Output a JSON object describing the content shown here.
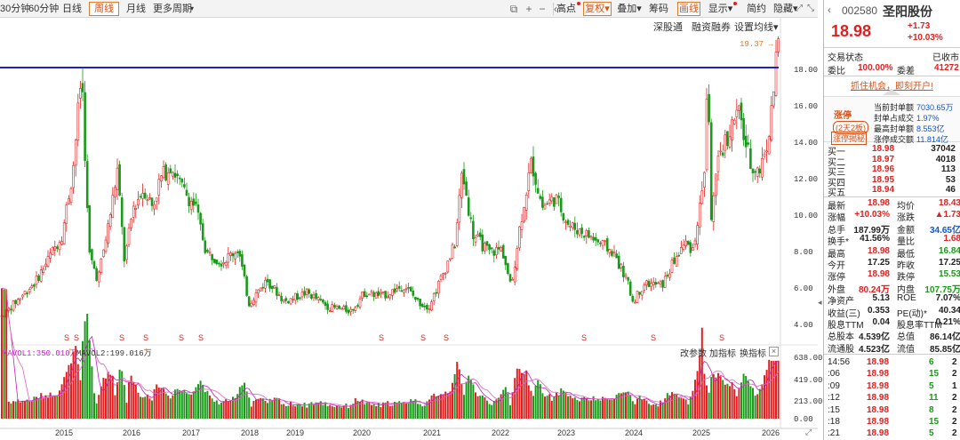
{
  "toolbar": {
    "periods": [
      "30分钟",
      "60分钟",
      "日线",
      "周线",
      "月线",
      "更多周期"
    ],
    "active_period": "周线",
    "right_buttons": [
      "高点",
      "复权",
      "叠加",
      "筹码",
      "画线",
      "显示",
      "简约",
      "隐藏"
    ],
    "icons": [
      "copy-icon",
      "plus-icon",
      "minus-icon",
      "prev-icon",
      "next-icon"
    ],
    "window_icons": [
      "restore-icon",
      "grid-icon",
      "collapse-icon"
    ]
  },
  "chart_links": [
    "深股通",
    "融资融券",
    "设置均线"
  ],
  "price_marker": "19.37",
  "reference_line_label": "",
  "y_axis_price": [
    "18.00",
    "16.00",
    "14.00",
    "12.00",
    "10.00",
    "8.00",
    "6.00",
    "4.00"
  ],
  "y_axis_volume": [
    "638.00",
    "419.00",
    "213.00",
    "0.00"
  ],
  "volume_header": {
    "mavol1": "MAVOL1:350.010万",
    "mavol2": "MAVOL2:199.016万",
    "links": [
      "改参数",
      "加指标",
      "换指标"
    ]
  },
  "years": [
    "2015",
    "2016",
    "2017",
    "2018",
    "2019",
    "2020",
    "2021",
    "2022",
    "2023",
    "2024",
    "2025",
    "2026"
  ],
  "dividend_marker": "S",
  "stock": {
    "code": "002580",
    "name": "圣阳股份",
    "price": "18.98",
    "change": "+1.73",
    "change_pct": "+10.03%"
  },
  "panel": {
    "trade_status_label": "交易状态",
    "trade_status": "已收市",
    "wb_label": "委比",
    "wb": "100.00%",
    "wc_label": "委差",
    "wc": "41272",
    "promo": "抓住机会，即刻开户!",
    "limit": {
      "tag": "涨停",
      "days": "(2天2板)",
      "reveal": "涨停揭秘",
      "rows": [
        {
          "label": "当前封单额",
          "value": "7030.65万"
        },
        {
          "label": "封单占成交",
          "value": "1.97%"
        },
        {
          "label": "最高封单额",
          "value": "8.553亿"
        },
        {
          "label": "涨停成交额",
          "value": "11.814亿"
        }
      ]
    },
    "bids": [
      {
        "label": "买一",
        "price": "18.98",
        "vol": "37042"
      },
      {
        "label": "买二",
        "price": "18.97",
        "vol": "4018"
      },
      {
        "label": "买三",
        "price": "18.96",
        "vol": "113"
      },
      {
        "label": "买四",
        "price": "18.95",
        "vol": "53"
      },
      {
        "label": "买五",
        "price": "18.94",
        "vol": "46"
      }
    ],
    "stats": [
      {
        "l1": "最新",
        "v1": "18.98",
        "c1": "red",
        "l2": "均价",
        "v2": "18.43",
        "c2": "red"
      },
      {
        "l1": "涨幅",
        "v1": "+10.03%",
        "c1": "red",
        "l2": "涨跌",
        "v2": "▲1.73",
        "c2": "red"
      },
      {
        "l1": "总手",
        "v1": "187.99万",
        "c1": "",
        "l2": "金额",
        "v2": "34.65亿",
        "c2": "blue"
      },
      {
        "l1": "换手*",
        "v1": "41.56%",
        "c1": "",
        "l2": "量比",
        "v2": "1.68",
        "c2": "red"
      },
      {
        "l1": "最高",
        "v1": "18.98",
        "c1": "red",
        "l2": "最低",
        "v2": "16.84",
        "c2": "green"
      },
      {
        "l1": "今开",
        "v1": "17.25",
        "c1": "",
        "l2": "昨收",
        "v2": "17.25",
        "c2": ""
      },
      {
        "l1": "涨停",
        "v1": "18.98",
        "c1": "red",
        "l2": "跌停",
        "v2": "15.53",
        "c2": "green"
      },
      {
        "l1": "外盘",
        "v1": "80.24万",
        "c1": "red",
        "l2": "内盘",
        "v2": "107.75万",
        "c2": "green"
      },
      {
        "l1": "净资产",
        "v1": "5.13",
        "c1": "",
        "l2": "ROE",
        "v2": "7.07%",
        "c2": ""
      },
      {
        "l1": "收益(三)",
        "v1": "0.353",
        "c1": "",
        "l2": "PE(动)*",
        "v2": "40.34",
        "c2": ""
      },
      {
        "l1": "股息TTM",
        "v1": "0.04",
        "c1": "",
        "l2": "股息率TTM",
        "v2": "0.21%",
        "c2": ""
      },
      {
        "l1": "总股本",
        "v1": "4.539亿",
        "c1": "",
        "l2": "总值",
        "v2": "86.14亿",
        "c2": ""
      },
      {
        "l1": "流通股",
        "v1": "4.523亿",
        "c1": "",
        "l2": "流值",
        "v2": "85.85亿",
        "c2": ""
      }
    ],
    "ticks": [
      {
        "time": "14:56",
        "price": "18.98",
        "vol": "6",
        "n": "2"
      },
      {
        "time": ":06",
        "price": "18.98",
        "vol": "15",
        "n": "2"
      },
      {
        "time": ":09",
        "price": "18.98",
        "vol": "5",
        "n": "1"
      },
      {
        "time": ":12",
        "price": "18.98",
        "vol": "11",
        "n": "2"
      },
      {
        "time": ":15",
        "price": "18.98",
        "vol": "8",
        "n": "2"
      },
      {
        "time": ":18",
        "price": "18.98",
        "vol": "15",
        "n": "2"
      },
      {
        "time": ":21",
        "price": "18.98",
        "vol": "5",
        "n": "2"
      }
    ]
  },
  "colors": {
    "up": "#e02020",
    "down": "#1a9a1a",
    "ref_line": "#1f1fd0",
    "accent": "#e07b2c",
    "ma_purple": "#c020c0",
    "ma_pink": "#e060c0"
  }
}
